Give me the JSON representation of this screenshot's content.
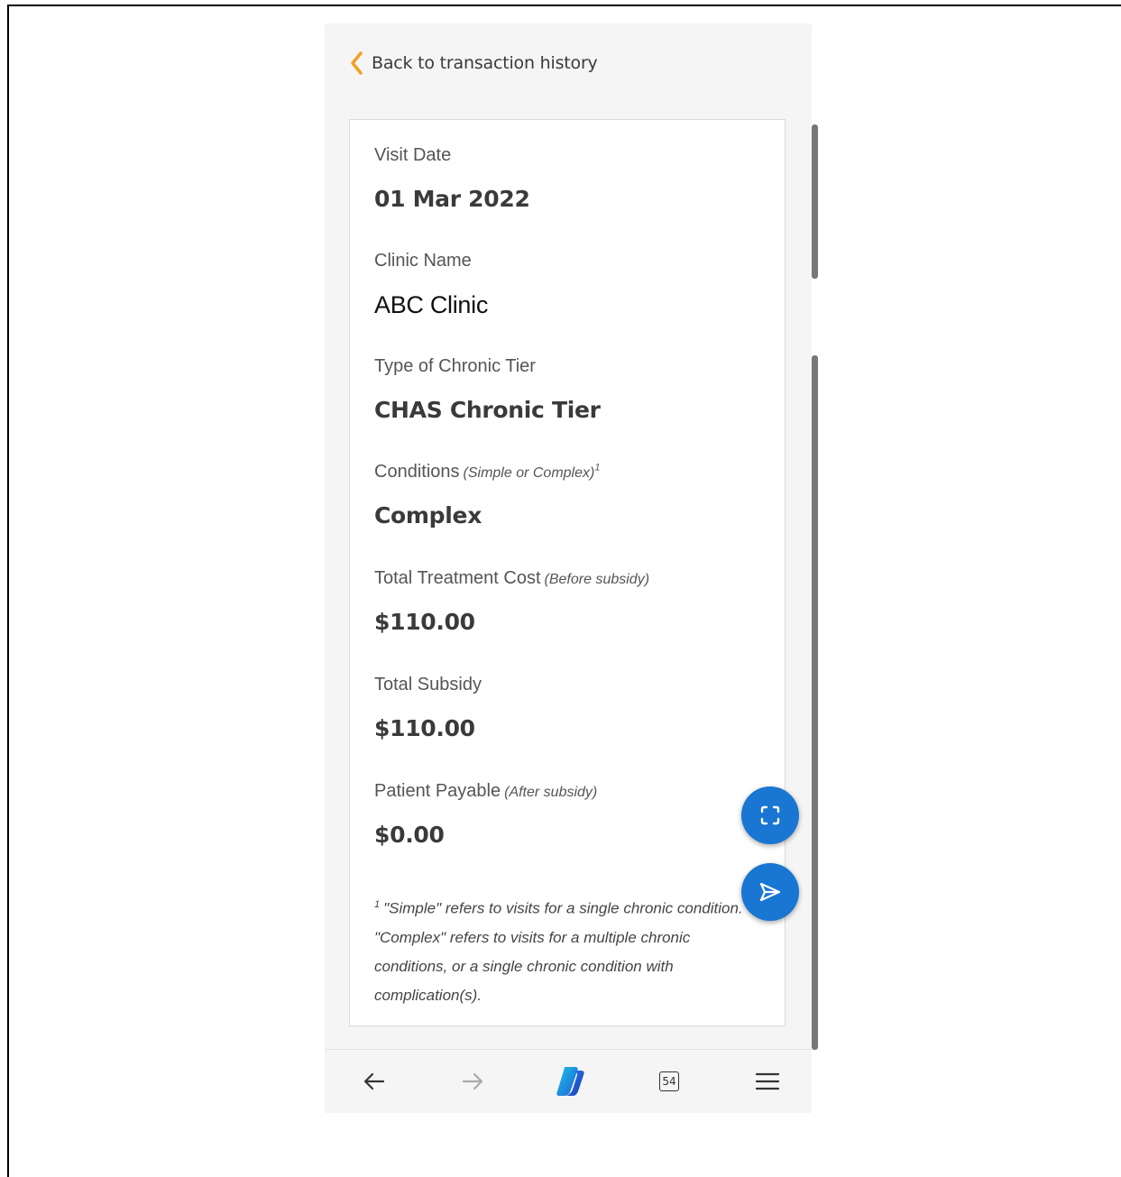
{
  "header": {
    "back_label": "Back to transaction history",
    "back_icon": "chevron-left-icon",
    "accent_color": "#f0a020"
  },
  "details": {
    "visit_date": {
      "label": "Visit Date",
      "value": "01 Mar 2022"
    },
    "clinic_name": {
      "label": "Clinic Name",
      "value": "ABC Clinic"
    },
    "chronic_tier": {
      "label": "Type of Chronic Tier",
      "value": "CHAS Chronic Tier"
    },
    "conditions": {
      "label": "Conditions",
      "note": "(Simple or Complex)",
      "sup": "1",
      "value": "Complex"
    },
    "treatment_cost": {
      "label": "Total Treatment Cost",
      "note": "(Before subsidy)",
      "value": "$110.00"
    },
    "subsidy": {
      "label": "Total Subsidy",
      "value": "$110.00"
    },
    "payable": {
      "label": "Patient Payable",
      "note": "(After subsidy)",
      "value": "$0.00"
    }
  },
  "footnote": {
    "marker": "1",
    "text": "\"Simple\" refers to visits for a single chronic condition. \"Complex\" refers to visits for a multiple chronic conditions, or a single chronic condition with complication(s)."
  },
  "fabs": {
    "screenshot_icon": "screenshot-frame-icon",
    "send_icon": "send-icon",
    "color": "#1976d2"
  },
  "browser_bar": {
    "back_icon": "arrow-left-icon",
    "forward_icon": "arrow-right-icon",
    "assistant_icon": "copilot-icon",
    "tab_count": "54",
    "menu_icon": "hamburger-menu-icon"
  }
}
